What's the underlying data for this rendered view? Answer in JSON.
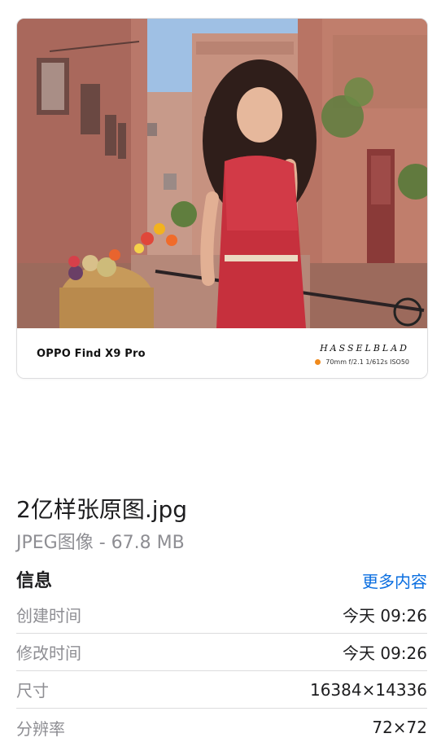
{
  "preview": {
    "device_model": "OPPO Find X9 Pro",
    "brand_logo": "HASSELBLAD",
    "exif": "70mm  f/2.1  1/612s  ISO50",
    "accent_color": "#f08a1c"
  },
  "file": {
    "name": "2亿样张原图.jpg",
    "type_size": "JPEG图像 - 67.8 MB"
  },
  "info": {
    "heading": "信息",
    "more_link": "更多内容",
    "rows": [
      {
        "label": "创建时间",
        "value": "今天 09:26"
      },
      {
        "label": "修改时间",
        "value": "今天 09:26"
      },
      {
        "label": "尺寸",
        "value": "16384×14336"
      },
      {
        "label": "分辨率",
        "value": "72×72"
      }
    ]
  },
  "colors": {
    "link": "#0a6ee0",
    "secondary_text": "#8e8e93"
  }
}
